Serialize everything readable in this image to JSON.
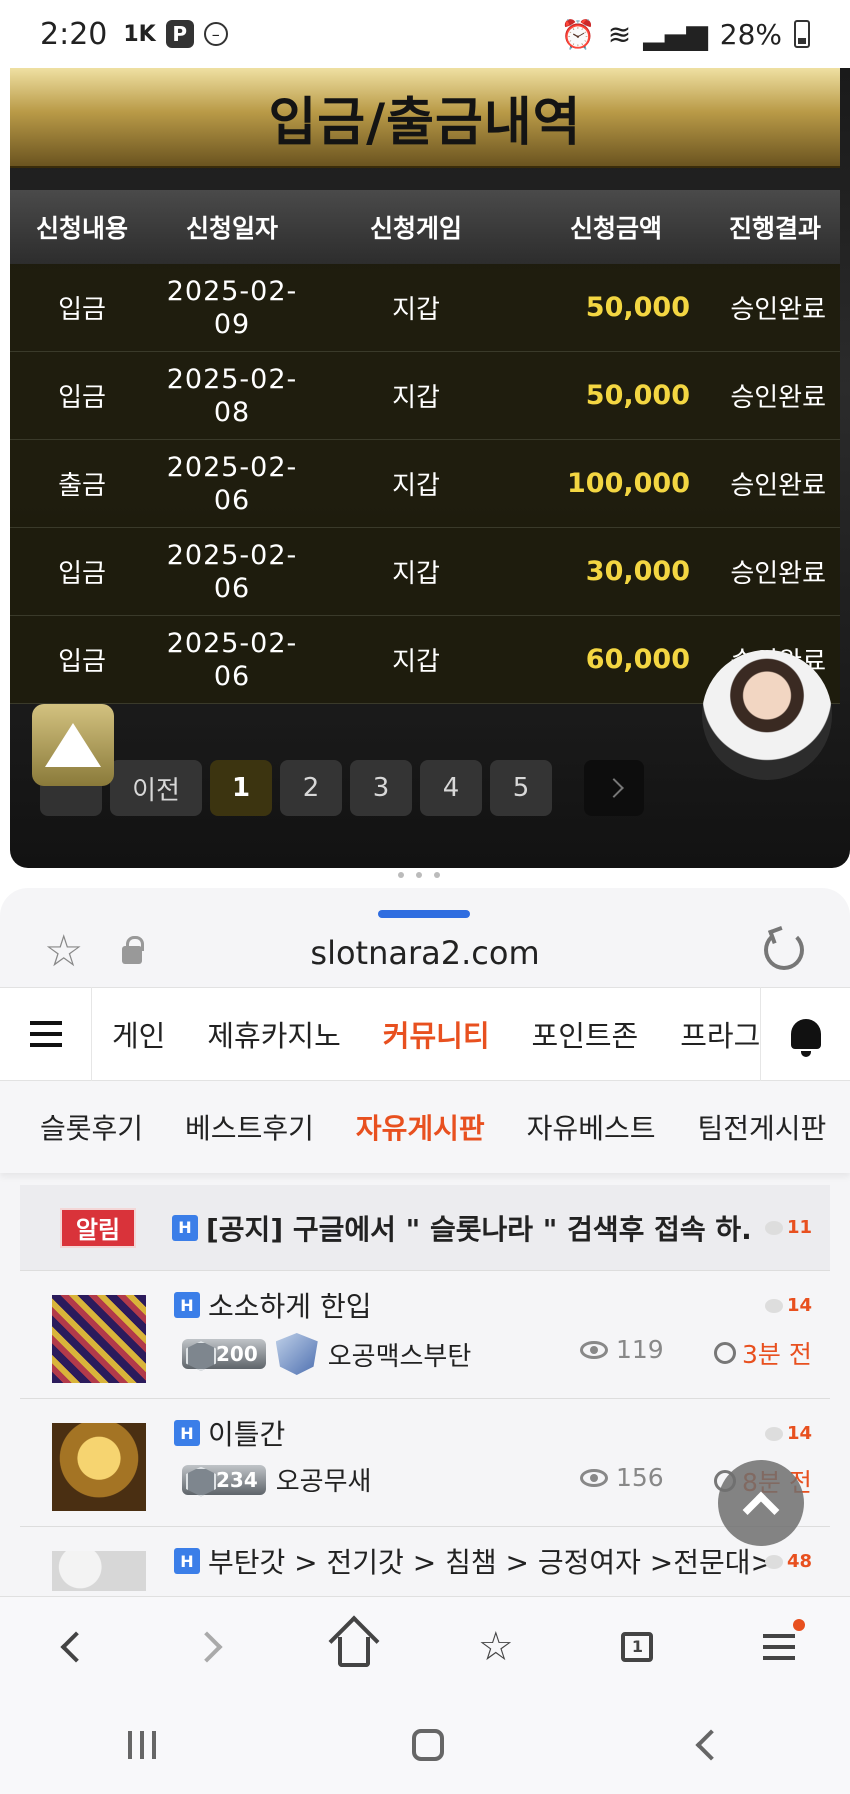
{
  "status_bar": {
    "time": "2:20",
    "icons": [
      "1k-icon",
      "p-icon",
      "dnd-icon"
    ],
    "battery": "28%"
  },
  "page": {
    "title": "입금/출금내역",
    "table": {
      "headers": [
        "신청내용",
        "신청일자",
        "신청게임",
        "신청금액",
        "진행결과"
      ],
      "rows": [
        {
          "type": "입금",
          "date": "2025-02-09",
          "game": "지갑",
          "amount": "50,000",
          "result": "승인완료"
        },
        {
          "type": "입금",
          "date": "2025-02-08",
          "game": "지갑",
          "amount": "50,000",
          "result": "승인완료"
        },
        {
          "type": "출금",
          "date": "2025-02-06",
          "game": "지갑",
          "amount": "100,000",
          "result": "승인완료"
        },
        {
          "type": "입금",
          "date": "2025-02-06",
          "game": "지갑",
          "amount": "30,000",
          "result": "승인완료"
        },
        {
          "type": "입금",
          "date": "2025-02-06",
          "game": "지갑",
          "amount": "60,000",
          "result": "승인완료"
        }
      ]
    },
    "pagination": {
      "prev_label": "이전",
      "pages": [
        "1",
        "2",
        "3",
        "4",
        "5"
      ],
      "current": "1"
    }
  },
  "browser": {
    "url": "slotnara2.com",
    "main_nav": {
      "items": [
        "게인",
        "제휴카지노",
        "커뮤니티",
        "포인트존",
        "프라그"
      ],
      "active": "커뮤니티"
    },
    "sub_nav": {
      "items": [
        "슬롯후기",
        "베스트후기",
        "자유게시판",
        "자유베스트",
        "팀전게시판"
      ],
      "active": "자유게시판"
    },
    "notice": {
      "badge": "알림",
      "title": "[공지] 구글에서 \" 슬롯나라 \" 검색후 접속 하...",
      "comments": "11"
    },
    "posts": [
      {
        "title": "소소하게 한입",
        "comments": "14",
        "level": "200",
        "author": "오공맥스부탄",
        "views": "119",
        "time": "3분 전"
      },
      {
        "title": "이틀간",
        "comments": "14",
        "level": "234",
        "author": "오공무새",
        "views": "156",
        "time": "8분 전"
      },
      {
        "title": "부탄갓 > 전기갓 > 침챔 > 긍정여자 >전문대>...",
        "comments": "48"
      }
    ],
    "hbadge_label": "H"
  },
  "colors": {
    "accent": "#e8501f",
    "amount": "#f3d642",
    "notice_badge": "#d9333a",
    "handle": "#2f6de0"
  }
}
